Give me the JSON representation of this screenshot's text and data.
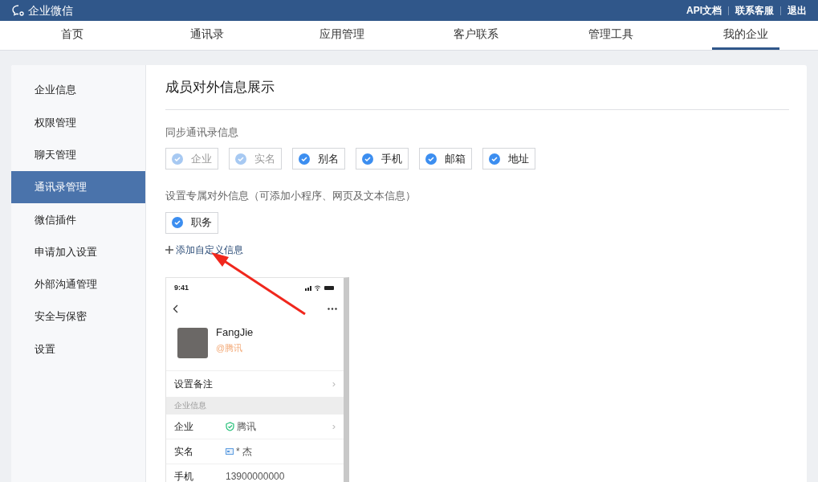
{
  "topbar": {
    "logo": "企业微信",
    "links": [
      "API文档",
      "联系客服",
      "退出"
    ]
  },
  "nav": [
    {
      "label": "首页",
      "selected": false
    },
    {
      "label": "通讯录",
      "selected": false
    },
    {
      "label": "应用管理",
      "selected": false
    },
    {
      "label": "客户联系",
      "selected": false
    },
    {
      "label": "管理工具",
      "selected": false
    },
    {
      "label": "我的企业",
      "selected": true
    }
  ],
  "sidebar": {
    "items": [
      {
        "label": "企业信息",
        "selected": false
      },
      {
        "label": "权限管理",
        "selected": false
      },
      {
        "label": "聊天管理",
        "selected": false
      },
      {
        "label": "通讯录管理",
        "selected": true
      },
      {
        "label": "微信插件",
        "selected": false
      },
      {
        "label": "申请加入设置",
        "selected": false
      },
      {
        "label": "外部沟通管理",
        "selected": false
      },
      {
        "label": "安全与保密",
        "selected": false
      },
      {
        "label": "设置",
        "selected": false
      }
    ]
  },
  "main": {
    "title": "成员对外信息展示",
    "sync_label": "同步通讯录信息",
    "sync_fields": [
      {
        "label": "企业",
        "checked": true,
        "disabled": true
      },
      {
        "label": "实名",
        "checked": true,
        "disabled": true
      },
      {
        "label": "别名",
        "checked": true,
        "disabled": false
      },
      {
        "label": "手机",
        "checked": true,
        "disabled": false
      },
      {
        "label": "邮箱",
        "checked": true,
        "disabled": false
      },
      {
        "label": "地址",
        "checked": true,
        "disabled": false
      }
    ],
    "custom_label": "设置专属对外信息（可添加小程序、网页及文本信息）",
    "custom_fields": [
      {
        "label": "职务",
        "checked": true,
        "disabled": false
      }
    ],
    "add_link": "添加自定义信息"
  },
  "phone": {
    "time": "9:41",
    "name": "FangJie",
    "company": "@腾讯",
    "remark": "设置备注",
    "remark_chevron": "›",
    "section": "企业信息",
    "rows": [
      {
        "label": "企业",
        "value": "腾讯",
        "kind": "verified",
        "chevron": "›"
      },
      {
        "label": "实名",
        "value": "* 杰",
        "kind": "id"
      },
      {
        "label": "手机",
        "value": "13900000000",
        "kind": "plain"
      }
    ]
  }
}
